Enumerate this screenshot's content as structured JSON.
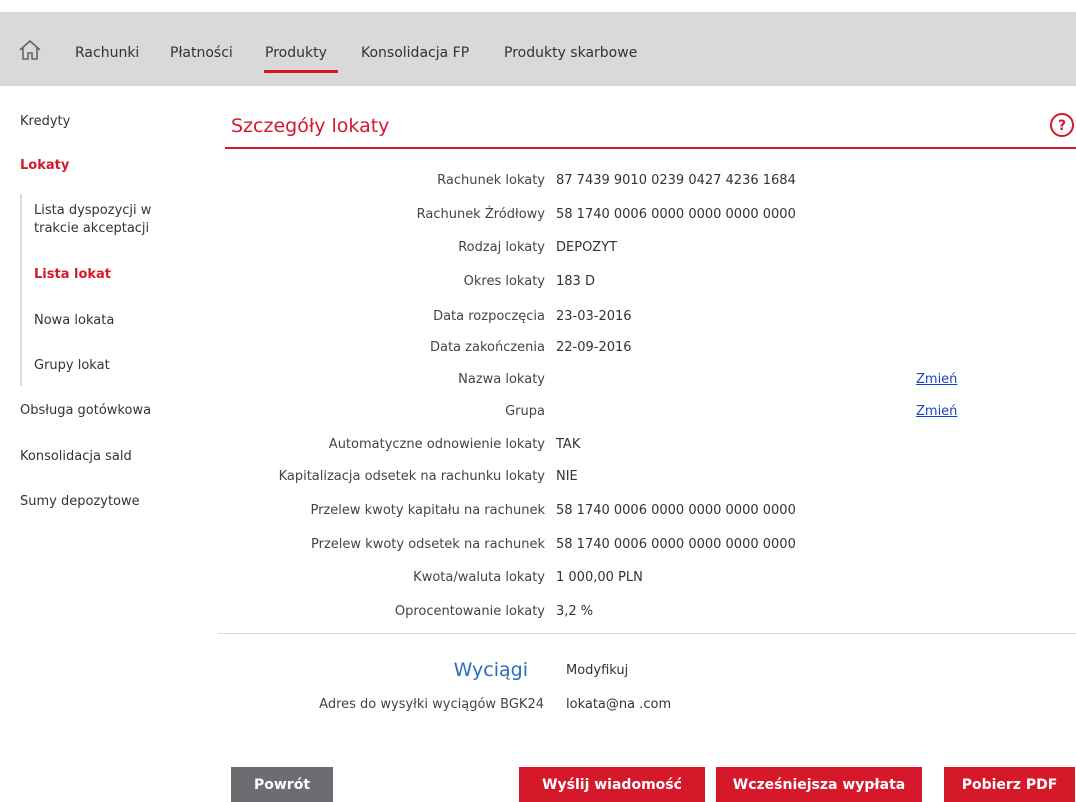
{
  "nav": {
    "items": [
      {
        "label": "Rachunki"
      },
      {
        "label": "Płatności"
      },
      {
        "label": "Produkty"
      },
      {
        "label": "Konsolidacja FP"
      },
      {
        "label": "Produkty skarbowe"
      }
    ],
    "active": "Produkty"
  },
  "sidebar": {
    "items": [
      {
        "label": "Kredyty"
      },
      {
        "label": "Lokaty"
      },
      {
        "label": "Obsługa gotówkowa"
      },
      {
        "label": "Konsolidacja sald"
      },
      {
        "label": "Sumy depozytowe"
      }
    ],
    "subitems": [
      {
        "label": "Lista dyspozycji w trakcie akceptacji"
      },
      {
        "label": "Lista lokat"
      },
      {
        "label": "Nowa lokata"
      },
      {
        "label": "Grupy lokat"
      }
    ]
  },
  "page": {
    "title": "Szczegóły lokaty",
    "details": [
      {
        "label": "Rachunek lokaty",
        "value": "87 7439 9010 0239 0427 4236 1684"
      },
      {
        "label": "Rachunek Źródłowy",
        "value": "58 1740 0006 0000 0000 0000 0000"
      },
      {
        "label": "Rodzaj lokaty",
        "value": "DEPOZYT"
      },
      {
        "label": "Okres lokaty",
        "value": "183 D"
      },
      {
        "label": "Data rozpoczęcia",
        "value": "23-03-2016"
      },
      {
        "label": "Data zakończenia",
        "value": "22-09-2016"
      },
      {
        "label": "Nazwa lokaty",
        "value": "",
        "link": "Zmień"
      },
      {
        "label": "Grupa",
        "value": "",
        "link": "Zmień"
      },
      {
        "label": "Automatyczne odnowienie lokaty",
        "value": "TAK"
      },
      {
        "label": "Kapitalizacja odsetek na rachunku lokaty",
        "value": "NIE"
      },
      {
        "label": "Przelew kwoty kapitału na rachunek",
        "value": "58 1740 0006 0000 0000 0000 0000"
      },
      {
        "label": "Przelew kwoty odsetek na rachunek",
        "value": "58 1740 0006 0000 0000 0000 0000"
      },
      {
        "label": "Kwota/waluta lokaty",
        "value": "1 000,00 PLN"
      },
      {
        "label": "Oprocentowanie lokaty",
        "value": "3,2 %"
      }
    ]
  },
  "statements": {
    "title": "Wyciągi",
    "modify": "Modyfikuj",
    "address_label": "Adres do wysyłki wyciągów BGK24",
    "address_value": "lokata@na .com"
  },
  "buttons": {
    "back": "Powrót",
    "send": "Wyślij wiadomość",
    "early": "Wcześniejsza wypłata",
    "pdf": "Pobierz PDF"
  },
  "colors": {
    "accent": "#d6182b",
    "link": "#1a3fc7",
    "section_title": "#2a6ebb",
    "topbar": "#d9d9d9",
    "button_gray": "#6b6d70"
  }
}
